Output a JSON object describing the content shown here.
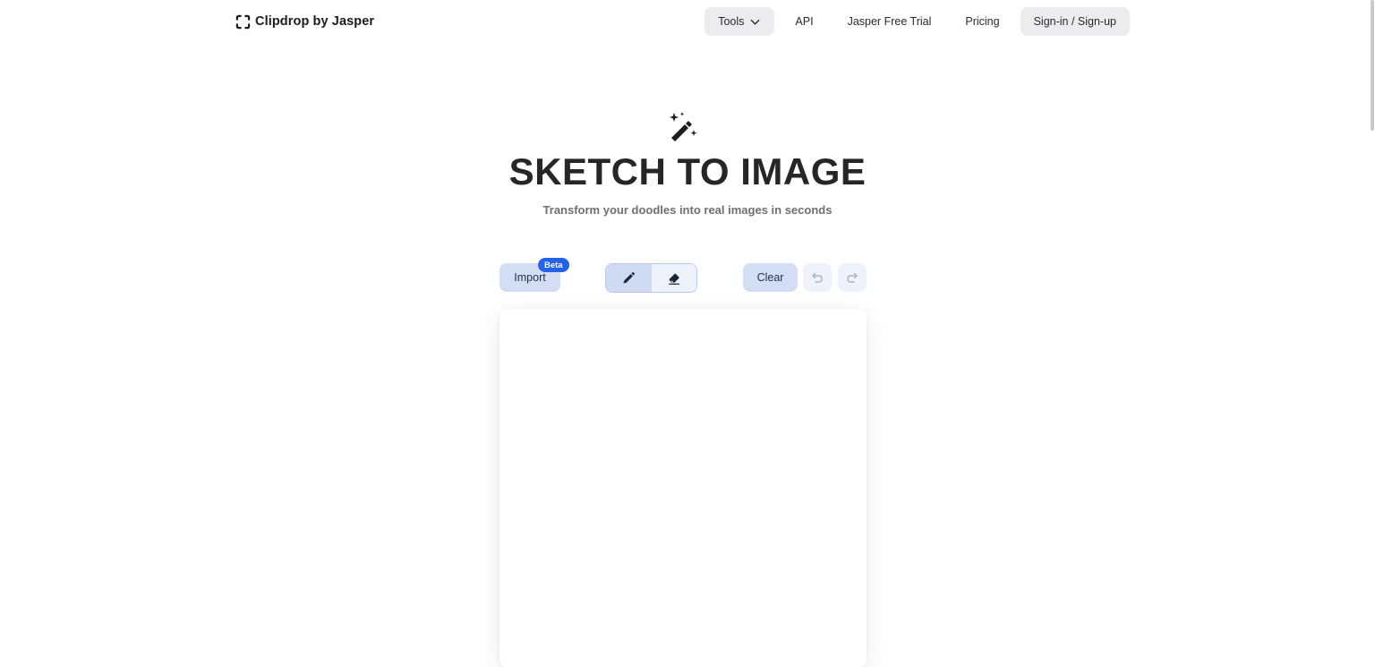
{
  "brand": {
    "name": "Clipdrop by Jasper",
    "logo_icon": "clipdrop-bracket-logo"
  },
  "nav": {
    "tools": "Tools",
    "api": "API",
    "trial": "Jasper Free Trial",
    "pricing": "Pricing",
    "signin": "Sign-in / Sign-up"
  },
  "hero": {
    "icon": "magic-wand-icon",
    "title": "SKETCH TO IMAGE",
    "subtitle": "Transform your doodles into real images in seconds"
  },
  "toolbar": {
    "import_label": "Import",
    "beta_badge": "Beta",
    "brush_icon": "pencil-icon",
    "eraser_icon": "eraser-icon",
    "active_tool": "pencil",
    "clear_label": "Clear",
    "undo_icon": "undo-icon",
    "redo_icon": "redo-icon"
  },
  "colors": {
    "accent": "#2462e8",
    "button_bg": "#d3def4",
    "nav_pill": "#ececee",
    "title": "#262626",
    "subtitle": "#6f6f73"
  }
}
